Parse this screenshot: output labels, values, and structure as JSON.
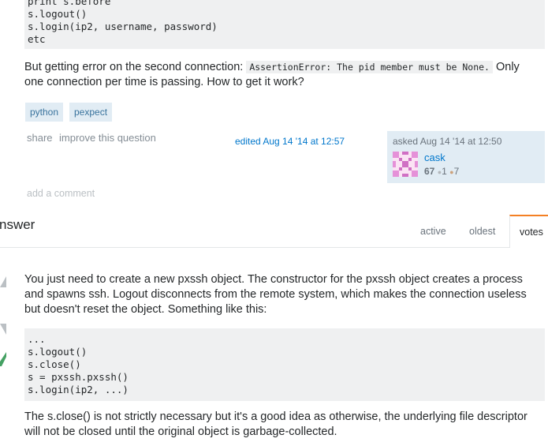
{
  "question": {
    "code_lines": [
      "print s.before",
      "s.logout()",
      "s.login(ip2, username, password)",
      "etc"
    ],
    "error_text_before": "But getting error on the second connection: ",
    "error_code": "AssertionError: The pid member must be None.",
    "error_text_after": " Only one connection per time is passing. How to get it work?",
    "tags": [
      "python",
      "pexpect"
    ],
    "menu": {
      "share": "share",
      "improve": "improve this question"
    },
    "edited": "edited Aug 14 '14 at 12:57",
    "asked": "asked Aug 14 '14 at 12:50",
    "user": {
      "name": "cask",
      "reputation": "67",
      "silver_badges": "1",
      "bronze_badges": "7"
    },
    "add_comment": "add a comment"
  },
  "answers_header": {
    "title": "nswer",
    "tabs": [
      "active",
      "oldest",
      "votes"
    ]
  },
  "answer": {
    "paragraph1": "You just need to create a new pxssh object. The constructor for the pxssh object creates a process and spawns ssh. Logout disconnects from the remote system, which makes the connection useless but doesn't reset the object. Something like this:",
    "code": "...\ns.logout()\ns.close()\ns = pxssh.pxssh()\ns.login(ip2, ...)",
    "paragraph2": "The s.close() is not strictly necessary but it's a good idea as otherwise, the underlying file descriptor will not be closed until the original object is garbage-collected."
  },
  "colors": {
    "link": "#0077cc",
    "tag_bg": "#e1ecf4",
    "tag_text": "#39739d",
    "code_bg": "#eff0f1",
    "accent_tab": "#f48024",
    "accepted": "#45a163"
  }
}
